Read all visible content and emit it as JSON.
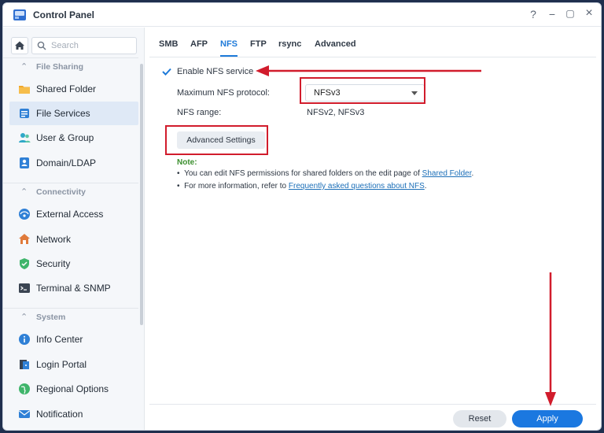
{
  "window": {
    "title": "Control Panel",
    "controls": [
      "?",
      "−",
      "▢",
      "×"
    ]
  },
  "sidebar": {
    "search_placeholder": "Search",
    "sections": [
      {
        "label": "File Sharing",
        "items": [
          {
            "label": "Shared Folder",
            "icon": "shared-folder-icon"
          },
          {
            "label": "File Services",
            "icon": "file-services-icon",
            "active": true
          },
          {
            "label": "User & Group",
            "icon": "user-group-icon"
          },
          {
            "label": "Domain/LDAP",
            "icon": "domain-ldap-icon"
          }
        ]
      },
      {
        "label": "Connectivity",
        "items": [
          {
            "label": "External Access",
            "icon": "external-access-icon"
          },
          {
            "label": "Network",
            "icon": "network-icon"
          },
          {
            "label": "Security",
            "icon": "security-icon"
          },
          {
            "label": "Terminal & SNMP",
            "icon": "terminal-icon"
          }
        ]
      },
      {
        "label": "System",
        "items": [
          {
            "label": "Info Center",
            "icon": "info-icon"
          },
          {
            "label": "Login Portal",
            "icon": "login-portal-icon"
          },
          {
            "label": "Regional Options",
            "icon": "regional-options-icon"
          },
          {
            "label": "Notification",
            "icon": "notification-icon"
          }
        ]
      }
    ]
  },
  "tabs": [
    "SMB",
    "AFP",
    "NFS",
    "FTP",
    "rsync",
    "Advanced"
  ],
  "active_tab": "NFS",
  "nfs": {
    "enable_label": "Enable NFS service",
    "enabled": true,
    "max_protocol_label": "Maximum NFS protocol:",
    "max_protocol_value": "NFSv3",
    "range_label": "NFS range:",
    "range_value": "NFSv2, NFSv3",
    "advanced_button": "Advanced Settings",
    "note_label": "Note:",
    "note1_prefix": "You can edit NFS permissions for shared folders on the edit page of ",
    "note1_link": "Shared Folder",
    "note1_suffix": ".",
    "note2_prefix": "For more information, refer to ",
    "note2_link": "Frequently asked questions about NFS",
    "note2_suffix": "."
  },
  "footer": {
    "reset_label": "Reset",
    "apply_label": "Apply"
  },
  "colors": {
    "accent": "#1b78e0",
    "annotation": "#d11c2c",
    "note": "#3b8f2e"
  }
}
